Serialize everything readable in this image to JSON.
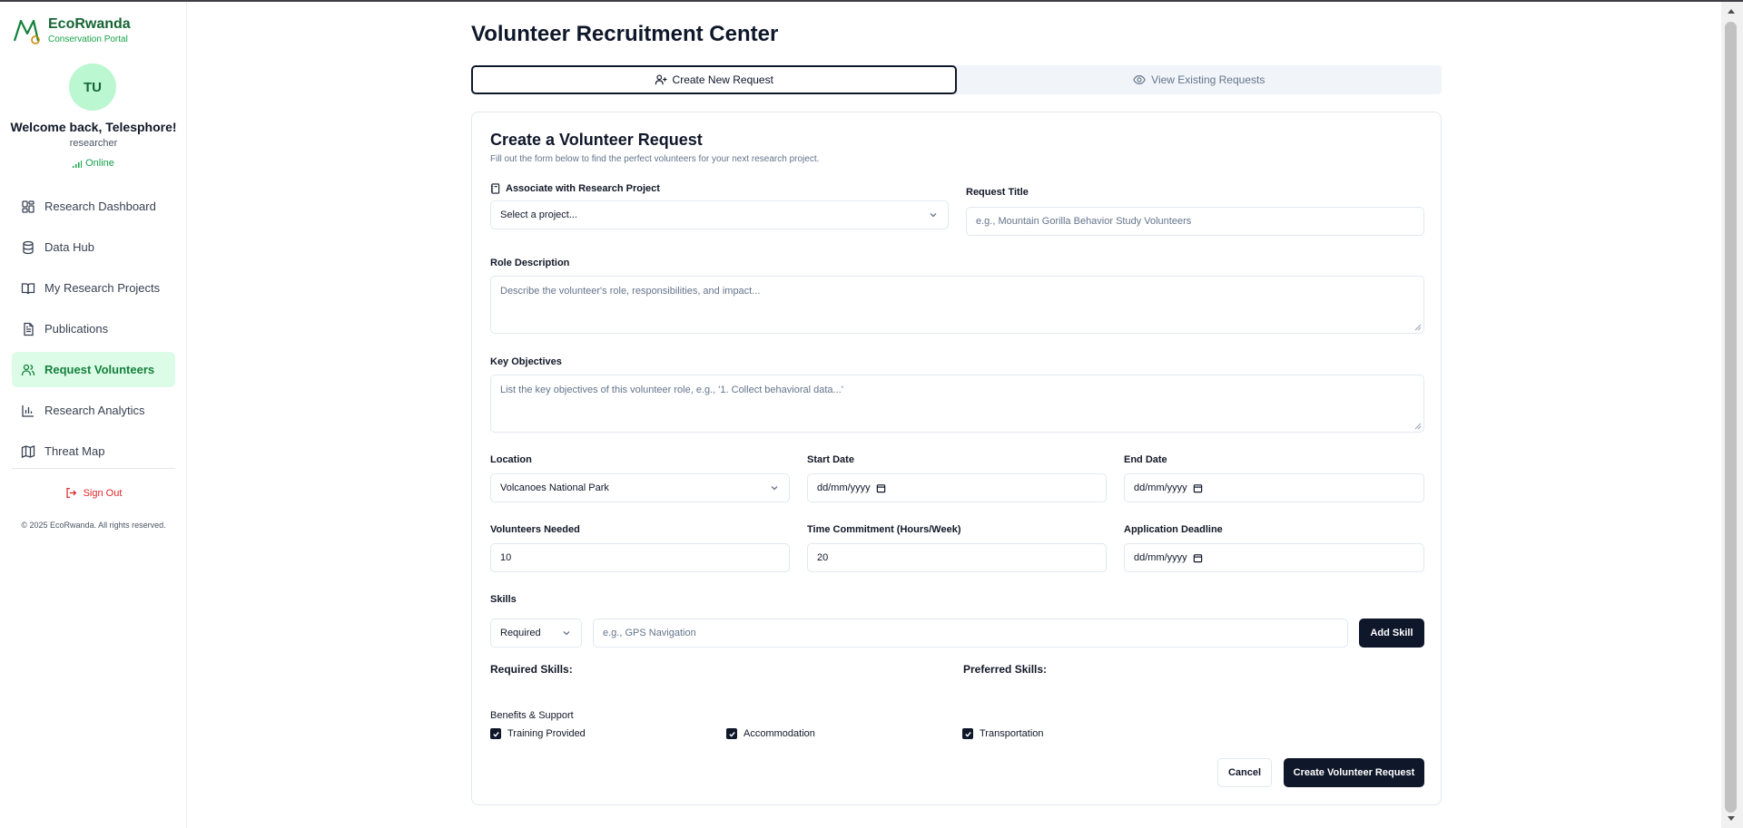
{
  "brand": {
    "name": "EcoRwanda",
    "subtitle": "Conservation Portal"
  },
  "user": {
    "initials": "TU",
    "welcome": "Welcome back, Telesphore!",
    "role": "researcher",
    "status": "Online"
  },
  "nav": [
    {
      "label": "Research Dashboard",
      "icon": "dashboard-grid-icon"
    },
    {
      "label": "Data Hub",
      "icon": "database-icon"
    },
    {
      "label": "My Research Projects",
      "icon": "book-open-icon"
    },
    {
      "label": "Publications",
      "icon": "document-icon"
    },
    {
      "label": "Request Volunteers",
      "icon": "users-icon",
      "active": true
    },
    {
      "label": "Research Analytics",
      "icon": "bar-chart-icon"
    },
    {
      "label": "Threat Map",
      "icon": "map-icon"
    }
  ],
  "signout": "Sign Out",
  "copyright": "© 2025 EcoRwanda. All rights reserved.",
  "page": {
    "title": "Volunteer Recruitment Center"
  },
  "tabs": [
    {
      "label": "Create New Request",
      "active": true
    },
    {
      "label": "View Existing Requests",
      "active": false
    }
  ],
  "form": {
    "title": "Create a Volunteer Request",
    "subtitle": "Fill out the form below to find the perfect volunteers for your next research project.",
    "project": {
      "label": "Associate with Research Project",
      "value": "Select a project..."
    },
    "request_title": {
      "label": "Request Title",
      "placeholder": "e.g., Mountain Gorilla Behavior Study Volunteers"
    },
    "role_description": {
      "label": "Role Description",
      "placeholder": "Describe the volunteer's role, responsibilities, and impact..."
    },
    "objectives": {
      "label": "Key Objectives",
      "placeholder": "List the key objectives of this volunteer role, e.g., '1. Collect behavioral data...'"
    },
    "location": {
      "label": "Location",
      "value": "Volcanoes National Park"
    },
    "start_date": {
      "label": "Start Date",
      "value": "dd/mm/yyyy"
    },
    "end_date": {
      "label": "End Date",
      "value": "dd/mm/yyyy"
    },
    "volunteers_needed": {
      "label": "Volunteers Needed",
      "value": "10"
    },
    "time_commitment": {
      "label": "Time Commitment (Hours/Week)",
      "value": "20"
    },
    "deadline": {
      "label": "Application Deadline",
      "value": "dd/mm/yyyy"
    },
    "skills": {
      "label": "Skills",
      "type_value": "Required",
      "placeholder": "e.g., GPS Navigation",
      "add_label": "Add Skill"
    },
    "required_skills_label": "Required Skills:",
    "preferred_skills_label": "Preferred Skills:",
    "benefits": {
      "label": "Benefits & Support",
      "items": [
        {
          "label": "Training Provided",
          "checked": true
        },
        {
          "label": "Accommodation",
          "checked": true
        },
        {
          "label": "Transportation",
          "checked": true
        }
      ]
    },
    "cancel_label": "Cancel",
    "submit_label": "Create Volunteer Request"
  },
  "colors": {
    "brand_green": "#166534",
    "accent_green": "#16a34a",
    "active_bg": "#dcfce7",
    "primary_dark": "#0f172a",
    "danger": "#dc2626"
  }
}
